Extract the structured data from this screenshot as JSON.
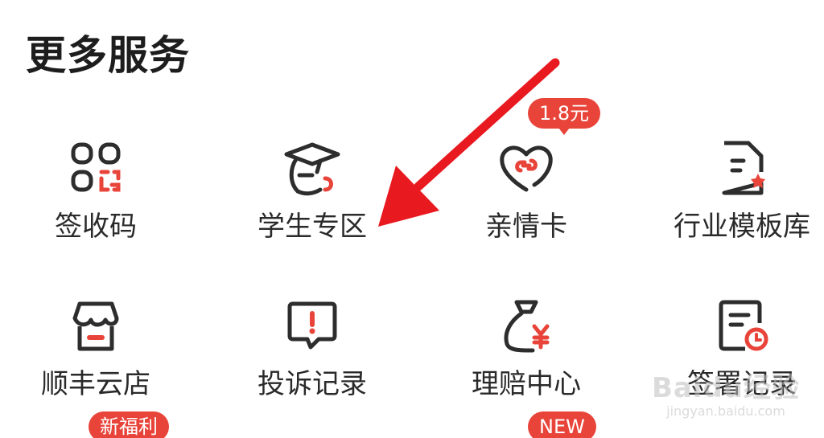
{
  "section": {
    "title": "更多服务"
  },
  "services": [
    {
      "label": "签收码",
      "icon": "qr-code-icon"
    },
    {
      "label": "学生专区",
      "icon": "graduation-cap-icon"
    },
    {
      "label": "亲情卡",
      "icon": "heart-link-icon",
      "badge": "1.8元"
    },
    {
      "label": "行业模板库",
      "icon": "template-document-icon"
    },
    {
      "label": "顺丰云店",
      "icon": "store-icon",
      "badge": "新福利"
    },
    {
      "label": "投诉记录",
      "icon": "complaint-icon"
    },
    {
      "label": "理赔中心",
      "icon": "money-bag-icon",
      "badge": "NEW"
    },
    {
      "label": "签署记录",
      "icon": "sign-record-icon"
    }
  ],
  "colors": {
    "accent": "#e8443a",
    "icon_stroke": "#2d2d2d",
    "arrow": "#e8191f"
  },
  "watermark": {
    "main": "Baidu经验",
    "sub": "jingyan.baidu.com"
  }
}
